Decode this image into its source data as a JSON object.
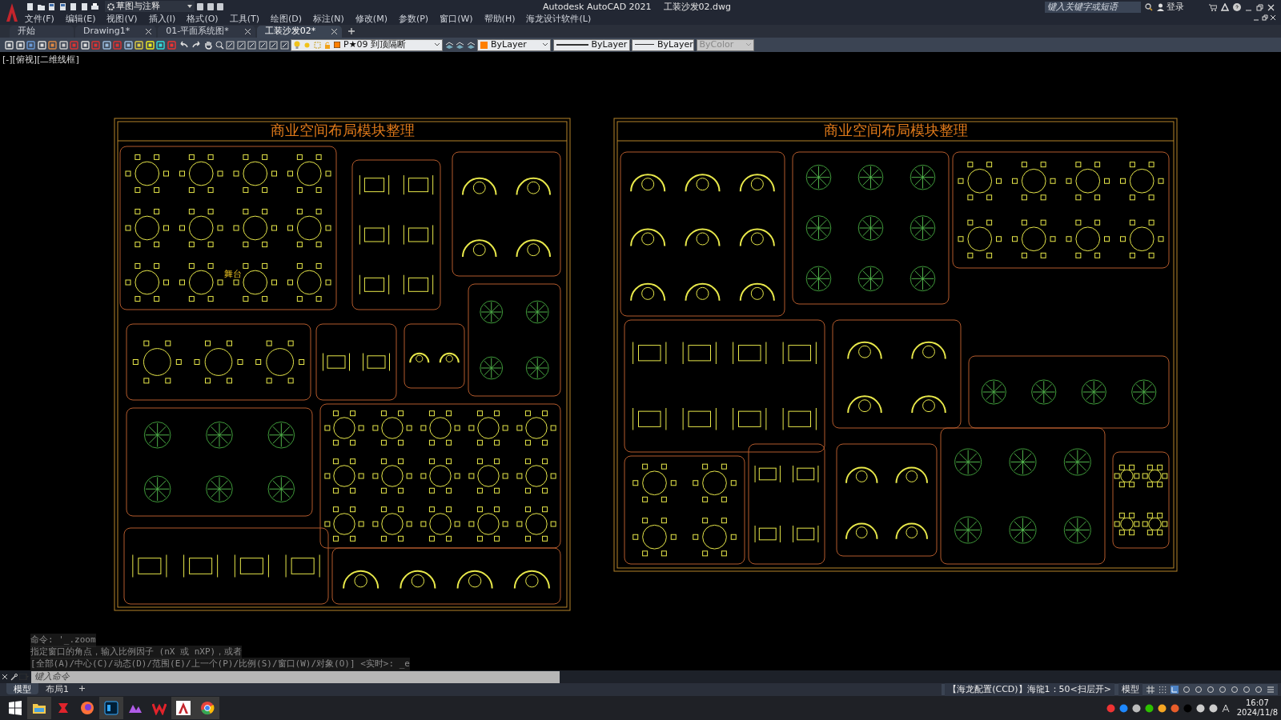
{
  "title_bar": {
    "workspace": "草图与注释",
    "app_name": "Autodesk AutoCAD 2021",
    "file_name": "工装沙发02.dwg",
    "search": {
      "placeholder": "键入关键字或短语"
    },
    "sign_in": "登录"
  },
  "menus": [
    "文件(F)",
    "编辑(E)",
    "视图(V)",
    "插入(I)",
    "格式(O)",
    "工具(T)",
    "绘图(D)",
    "标注(N)",
    "修改(M)",
    "参数(P)",
    "窗口(W)",
    "帮助(H)",
    "海龙设计软件(L)"
  ],
  "doc_tabs": [
    {
      "label": "开始",
      "selected": false,
      "closable": false
    },
    {
      "label": "Drawing1*",
      "selected": false,
      "closable": true
    },
    {
      "label": "01-平面系统图*",
      "selected": false,
      "closable": true
    },
    {
      "label": "工装沙发02*",
      "selected": true,
      "closable": true
    }
  ],
  "properties": {
    "layer": "P★09 到顶隔断",
    "color": {
      "label": "ByLayer",
      "color": "#ff7f00"
    },
    "linetype": "ByLayer",
    "lineweight": "ByLayer",
    "plot_style": {
      "label": "ByColor",
      "disabled": true
    }
  },
  "viewport_label": "[-][俯视][二维线框]",
  "sheets": [
    {
      "title": "商业空间布局模块整理",
      "labels": [
        "舞台"
      ]
    },
    {
      "title": "商业空间布局模块整理"
    }
  ],
  "command_history": [
    "命令: '_.zoom",
    "指定窗口的角点，输入比例因子 (nX 或 nXP)，或者",
    "[全部(A)/中心(C)/动态(D)/范围(E)/上一个(P)/比例(S)/窗口(W)/对象(O)] <实时>: _e"
  ],
  "command_input": {
    "placeholder": "键入命令"
  },
  "layout_tabs": [
    {
      "label": "模型",
      "selected": true
    },
    {
      "label": "布局1",
      "selected": false
    }
  ],
  "status_bar": {
    "annotation": "【海龙配置(CCD)】海龍1：50<扫层开>",
    "space": "模型"
  },
  "taskbar": {
    "time": "16:07",
    "date": "2024/11/8"
  }
}
